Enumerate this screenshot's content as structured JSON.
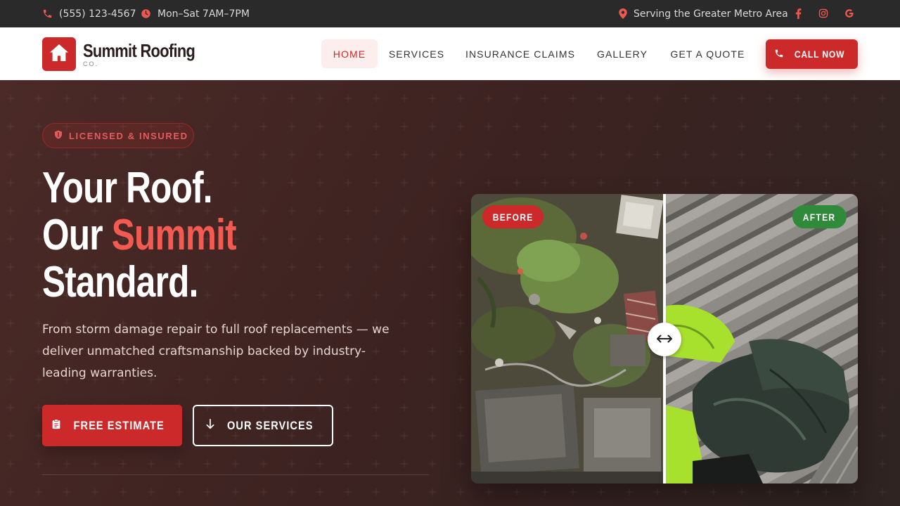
{
  "topbar": {
    "phone": "(555) 123-4567",
    "hours": "Mon–Sat 7AM–7PM",
    "service_area": "Serving the Greater Metro Area",
    "icons": [
      "phone-icon",
      "clock-icon",
      "map-pin-icon",
      "facebook-icon",
      "instagram-icon",
      "google-icon"
    ]
  },
  "brand": {
    "name": "Summit Roofing",
    "suffix": "CO.",
    "logo_icon": "house-icon"
  },
  "nav": {
    "items": [
      {
        "label": "HOME",
        "active": true
      },
      {
        "label": "SERVICES",
        "active": false
      },
      {
        "label": "INSURANCE CLAIMS",
        "active": false
      },
      {
        "label": "GALLERY",
        "active": false
      },
      {
        "label": "GET A QUOTE",
        "active": false
      }
    ],
    "call_label": "CALL NOW"
  },
  "hero": {
    "badge": "LICENSED & INSURED",
    "headline_line1": "Your Roof.",
    "headline_line2_prefix": "Our ",
    "headline_line2_accent": "Summit",
    "headline_line3": "Standard.",
    "lead": "From storm damage repair to full roof replacements — we deliver unmatched craftsmanship backed by industry-leading warranties.",
    "primary_cta": "FREE ESTIMATE",
    "secondary_cta": "OUR SERVICES"
  },
  "comparison": {
    "before_label": "BEFORE",
    "after_label": "AFTER",
    "split_position": 0.5
  },
  "colors": {
    "brand_red": "#cc2a2a",
    "accent_red": "#f25a52",
    "after_green": "#2f8a3a",
    "topbar_bg": "#2a2a2a",
    "hero_bg": "#3d2321"
  }
}
